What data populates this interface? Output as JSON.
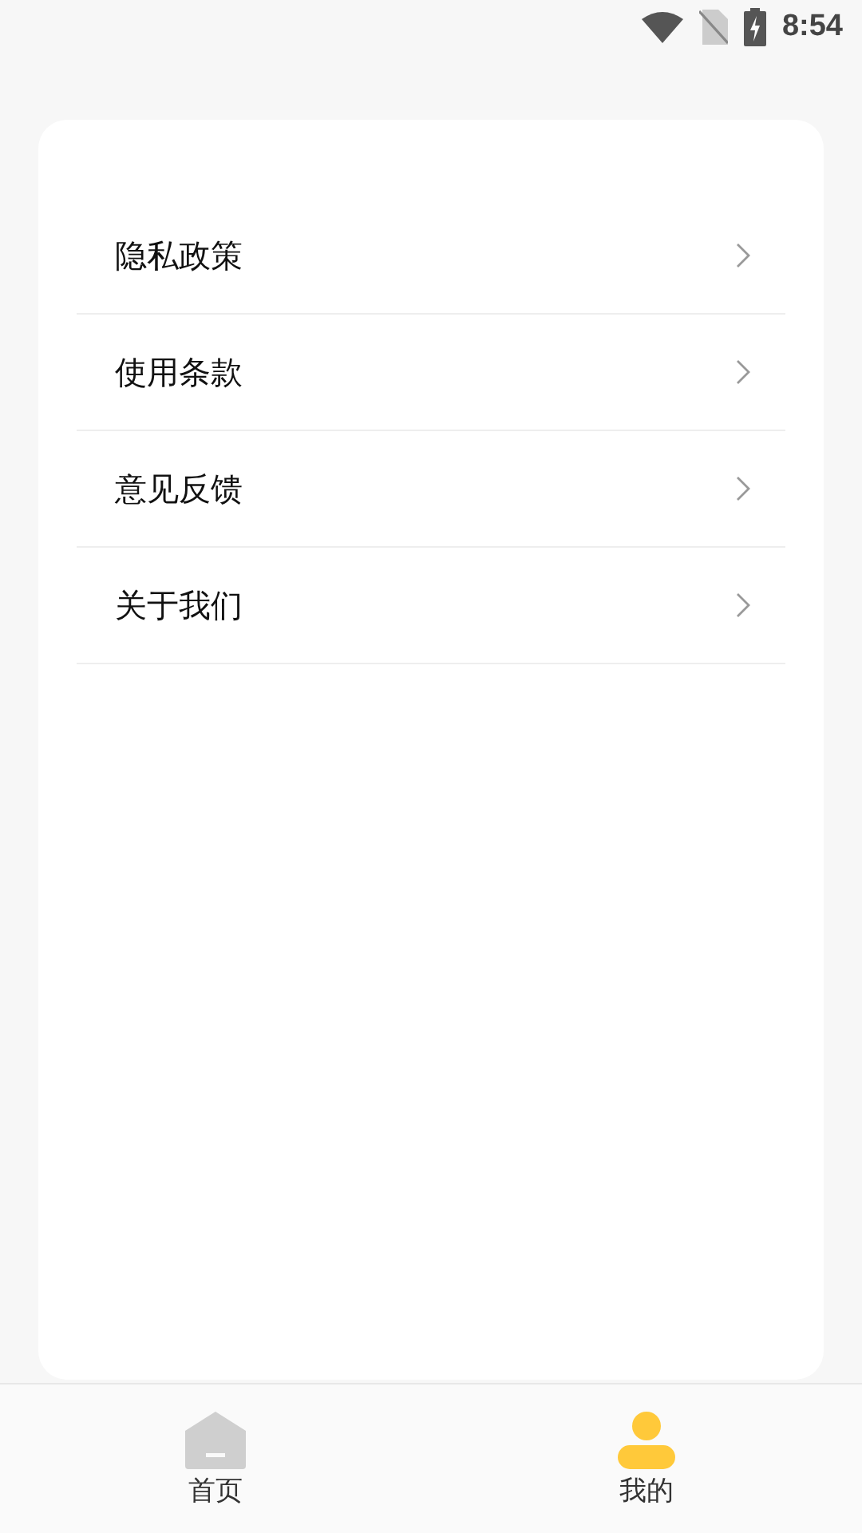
{
  "status_bar": {
    "time": "8:54"
  },
  "menu": {
    "items": [
      {
        "label": "隐私政策"
      },
      {
        "label": "使用条款"
      },
      {
        "label": "意见反馈"
      },
      {
        "label": "关于我们"
      }
    ]
  },
  "tab_bar": {
    "tabs": [
      {
        "kind": "home",
        "label": "首页",
        "selected": false
      },
      {
        "kind": "profile",
        "label": "我的",
        "selected": true
      }
    ]
  }
}
